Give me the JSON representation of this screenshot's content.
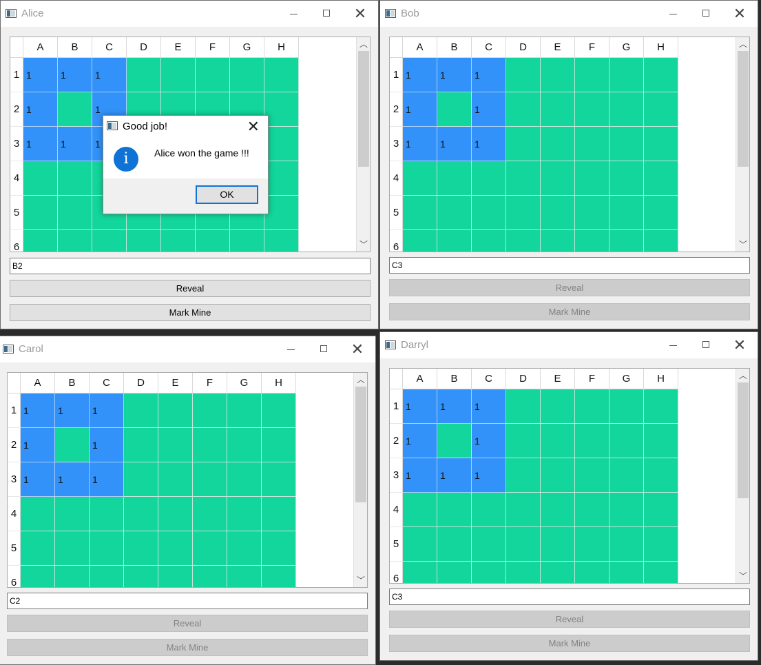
{
  "columns": [
    "A",
    "B",
    "C",
    "D",
    "E",
    "F",
    "G",
    "H"
  ],
  "rows": [
    "1",
    "2",
    "3",
    "4",
    "5",
    "6"
  ],
  "board": [
    [
      "1",
      "1",
      "1",
      null,
      null,
      null,
      null,
      null
    ],
    [
      "1",
      null,
      "1",
      null,
      null,
      null,
      null,
      null
    ],
    [
      "1",
      "1",
      "1",
      null,
      null,
      null,
      null,
      null
    ],
    [
      null,
      null,
      null,
      null,
      null,
      null,
      null,
      null
    ],
    [
      null,
      null,
      null,
      null,
      null,
      null,
      null,
      null
    ],
    [
      null,
      null,
      null,
      null,
      null,
      null,
      null,
      null
    ]
  ],
  "revealed": [
    [
      true,
      true,
      true,
      false,
      false,
      false,
      false,
      false
    ],
    [
      true,
      false,
      true,
      false,
      false,
      false,
      false,
      false
    ],
    [
      true,
      true,
      true,
      false,
      false,
      false,
      false,
      false
    ],
    [
      false,
      false,
      false,
      false,
      false,
      false,
      false,
      false
    ],
    [
      false,
      false,
      false,
      false,
      false,
      false,
      false,
      false
    ],
    [
      false,
      false,
      false,
      false,
      false,
      false,
      false,
      false
    ]
  ],
  "colors": {
    "revealed": "#3292f9",
    "hidden": "#12d69b"
  },
  "windows": [
    {
      "title": "Alice",
      "input": "B2",
      "reveal_label": "Reveal",
      "mark_label": "Mark Mine",
      "buttons_enabled": true
    },
    {
      "title": "Bob",
      "input": "C3",
      "reveal_label": "Reveal",
      "mark_label": "Mark Mine",
      "buttons_enabled": false
    },
    {
      "title": "Carol",
      "input": "C2",
      "reveal_label": "Reveal",
      "mark_label": "Mark Mine",
      "buttons_enabled": false
    },
    {
      "title": "Darryl",
      "input": "C3",
      "reveal_label": "Reveal",
      "mark_label": "Mark Mine",
      "buttons_enabled": false
    }
  ],
  "dialog": {
    "title": "Good job!",
    "message": "Alice won the game !!!",
    "ok_label": "OK",
    "icon": "info-icon"
  }
}
